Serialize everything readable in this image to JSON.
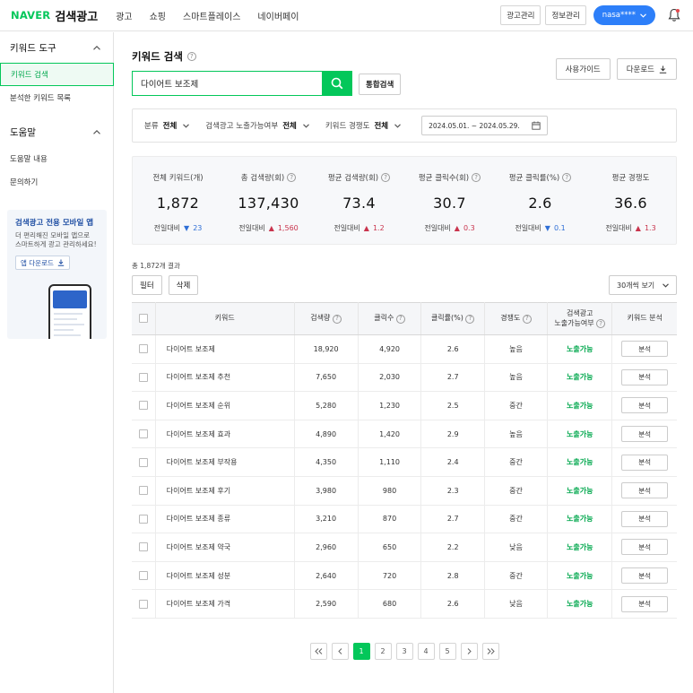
{
  "header": {
    "brand": "NAVER",
    "service": "검색광고",
    "nav": [
      "광고",
      "쇼핑",
      "스마트플레이스",
      "네이버페이"
    ],
    "ad_manage": "광고관리",
    "info_manage": "정보관리",
    "account": "nasa****"
  },
  "sidebar": {
    "section1": "키워드 도구",
    "item_search": "키워드 검색",
    "item_list": "분석한 키워드 목록",
    "section2": "도움말",
    "item_help": "도움말 내용",
    "item_inquiry": "문의하기",
    "promo_title": "검색광고 전용 모바일 앱",
    "promo_line1": "더 편리해진 모바일 앱으로",
    "promo_line2": "스마트하게 광고 관리하세요!",
    "promo_button": "앱 다운로드"
  },
  "page": {
    "title": "키워드 검색",
    "guide": "사용가이드",
    "download": "다운로드",
    "search_value": "다이어트 보조제",
    "integrated": "통합검색"
  },
  "filters": {
    "category_label": "분류",
    "category_value": "전체",
    "exposure_label": "검색광고 노출가능여부",
    "exposure_value": "전체",
    "competition_label": "키워드 경쟁도",
    "competition_value": "전체",
    "date_range": "2024.05.01. ~ 2024.05.29."
  },
  "stats": [
    {
      "label": "전체 키워드(개)",
      "value": "1,872",
      "cmp": "전일대비",
      "dir": "down",
      "delta": "23",
      "help": false
    },
    {
      "label": "총 검색량(회)",
      "value": "137,430",
      "cmp": "전일대비",
      "dir": "up",
      "delta": "1,560",
      "help": true
    },
    {
      "label": "평균 검색량(회)",
      "value": "73.4",
      "cmp": "전일대비",
      "dir": "up",
      "delta": "1.2",
      "help": true
    },
    {
      "label": "평균 클릭수(회)",
      "value": "30.7",
      "cmp": "전일대비",
      "dir": "up",
      "delta": "0.3",
      "help": true
    },
    {
      "label": "평균 클릭률(%)",
      "value": "2.6",
      "cmp": "전일대비",
      "dir": "down",
      "delta": "0.1",
      "help": true
    },
    {
      "label": "평균 경쟁도",
      "value": "36.6",
      "cmp": "전일대비",
      "dir": "up",
      "delta": "1.3",
      "help": false
    }
  ],
  "results": {
    "total": "총 1,872개 결과",
    "filter": "필터",
    "delete": "삭제",
    "view": "30개씩 보기"
  },
  "table": {
    "headers": {
      "keyword": "키워드",
      "volume": "검색량",
      "clicks": "클릭수",
      "ctr": "클릭률(%)",
      "competition": "경쟁도",
      "exposure_1": "검색광고",
      "exposure_2": "노출가능여부",
      "analysis": "키워드 분석"
    },
    "rows": [
      {
        "keyword": "다이어트 보조제",
        "volume": "18,920",
        "clicks": "4,920",
        "ctr": "2.6",
        "comp": "높음",
        "exp": "노출가능",
        "btn": "분석"
      },
      {
        "keyword": "다이어트 보조제 추천",
        "volume": "7,650",
        "clicks": "2,030",
        "ctr": "2.7",
        "comp": "높음",
        "exp": "노출가능",
        "btn": "분석"
      },
      {
        "keyword": "다이어트 보조제 순위",
        "volume": "5,280",
        "clicks": "1,230",
        "ctr": "2.5",
        "comp": "중간",
        "exp": "노출가능",
        "btn": "분석"
      },
      {
        "keyword": "다이어트 보조제 효과",
        "volume": "4,890",
        "clicks": "1,420",
        "ctr": "2.9",
        "comp": "높음",
        "exp": "노출가능",
        "btn": "분석"
      },
      {
        "keyword": "다이어트 보조제 부작용",
        "volume": "4,350",
        "clicks": "1,110",
        "ctr": "2.4",
        "comp": "중간",
        "exp": "노출가능",
        "btn": "분석"
      },
      {
        "keyword": "다이어트 보조제 후기",
        "volume": "3,980",
        "clicks": "980",
        "ctr": "2.3",
        "comp": "중간",
        "exp": "노출가능",
        "btn": "분석"
      },
      {
        "keyword": "다이어트 보조제 종류",
        "volume": "3,210",
        "clicks": "870",
        "ctr": "2.7",
        "comp": "중간",
        "exp": "노출가능",
        "btn": "분석"
      },
      {
        "keyword": "다이어트 보조제 약국",
        "volume": "2,960",
        "clicks": "650",
        "ctr": "2.2",
        "comp": "낮음",
        "exp": "노출가능",
        "btn": "분석"
      },
      {
        "keyword": "다이어트 보조제 성분",
        "volume": "2,640",
        "clicks": "720",
        "ctr": "2.8",
        "comp": "중간",
        "exp": "노출가능",
        "btn": "분석"
      },
      {
        "keyword": "다이어트 보조제 가격",
        "volume": "2,590",
        "clicks": "680",
        "ctr": "2.6",
        "comp": "낮음",
        "exp": "노출가능",
        "btn": "분석"
      }
    ]
  },
  "pagination": {
    "pages": [
      "1",
      "2",
      "3",
      "4",
      "5"
    ],
    "current": "1"
  },
  "colors": {
    "brand_green": "#03c75a",
    "account_blue": "#2d7ff9",
    "up_red": "#c9344d",
    "down_blue": "#2f6fd6"
  }
}
